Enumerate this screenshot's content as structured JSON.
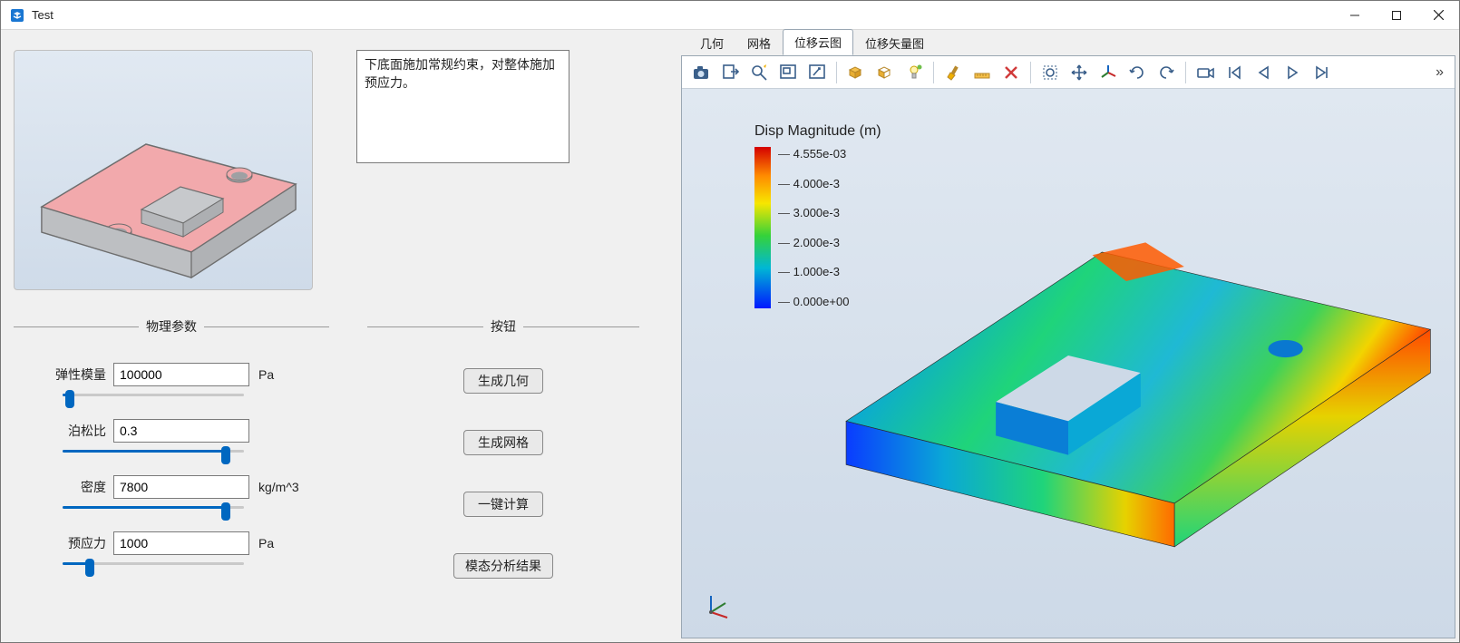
{
  "window": {
    "title": "Test"
  },
  "description": "下底面施加常规约束，对整体施加预应力。",
  "groups": {
    "params_title": "物理参数",
    "buttons_title": "按钮"
  },
  "params": {
    "young": {
      "label": "弹性模量",
      "value": "100000",
      "unit": "Pa",
      "slider_pct": 4
    },
    "poisson": {
      "label": "泊松比",
      "value": "0.3",
      "unit": "",
      "slider_pct": 90
    },
    "density": {
      "label": "密度",
      "value": "7800",
      "unit": "kg/m^3",
      "slider_pct": 90
    },
    "prestress": {
      "label": "预应力",
      "value": "1000",
      "unit": "Pa",
      "slider_pct": 15
    }
  },
  "buttons": {
    "gen_geo": "生成几何",
    "gen_mesh": "生成网格",
    "compute": "一键计算",
    "modal": "模态分析结果"
  },
  "right_tabs": {
    "geo": "几何",
    "mesh": "网格",
    "disp_cloud": "位移云图",
    "disp_vec": "位移矢量图",
    "active": "disp_cloud"
  },
  "colorbar": {
    "title": "Disp Magnitude (m)",
    "ticks": [
      "4.555e-03",
      "4.000e-3",
      "3.000e-3",
      "2.000e-3",
      "1.000e-3",
      "0.000e+00"
    ]
  },
  "toolbar_icons": [
    "camera",
    "export",
    "zoom-fit",
    "zoom-box",
    "zoom-area",
    "box-select",
    "face-select",
    "light",
    "brush",
    "ruler",
    "delete",
    "crop-select",
    "pan-all",
    "axes",
    "rotate-cw",
    "rotate-ccw",
    "video",
    "go-first",
    "step-back",
    "play",
    "step-forward"
  ]
}
